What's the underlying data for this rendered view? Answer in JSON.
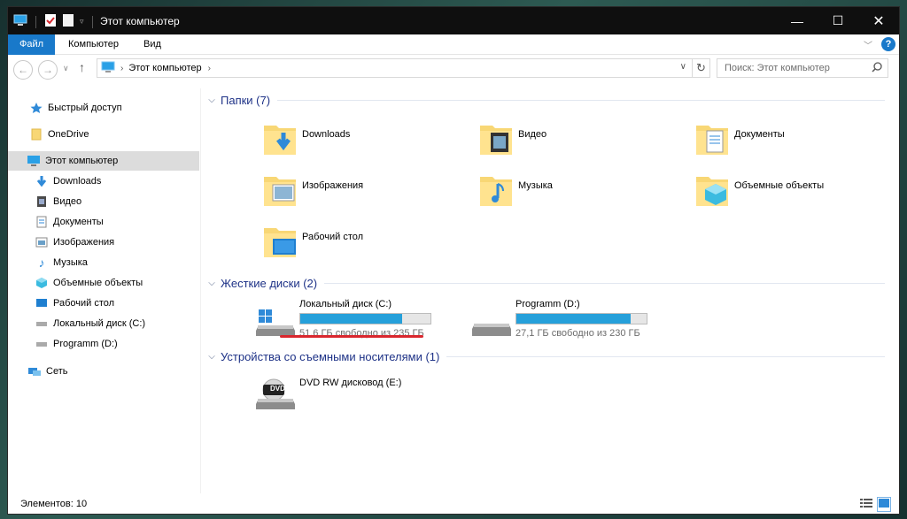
{
  "window": {
    "title": "Этот компьютер"
  },
  "ribbon": {
    "tabs": [
      "Файл",
      "Компьютер",
      "Вид"
    ]
  },
  "address": {
    "path": "Этот компьютер",
    "search_placeholder": "Поиск: Этот компьютер"
  },
  "sidebar": {
    "items": [
      {
        "label": "Быстрый доступ",
        "icon": "star-icon"
      },
      {
        "label": "OneDrive",
        "icon": "onedrive-icon"
      },
      {
        "label": "Этот компьютер",
        "icon": "computer-icon"
      },
      {
        "label": "Downloads",
        "icon": "download-icon"
      },
      {
        "label": "Видео",
        "icon": "video-icon"
      },
      {
        "label": "Документы",
        "icon": "document-icon"
      },
      {
        "label": "Изображения",
        "icon": "image-icon"
      },
      {
        "label": "Музыка",
        "icon": "music-icon"
      },
      {
        "label": "Объемные объекты",
        "icon": "cube-icon"
      },
      {
        "label": "Рабочий стол",
        "icon": "desktop-icon"
      },
      {
        "label": "Локальный диск (C:)",
        "icon": "drive-icon"
      },
      {
        "label": "Programm (D:)",
        "icon": "drive-icon"
      },
      {
        "label": "Сеть",
        "icon": "network-icon"
      }
    ]
  },
  "groups": {
    "folders": {
      "title": "Папки (7)"
    },
    "drives": {
      "title": "Жесткие диски (2)"
    },
    "removable": {
      "title": "Устройства со съемными носителями (1)"
    }
  },
  "folders": [
    "Downloads",
    "Видео",
    "Документы",
    "Изображения",
    "Музыка",
    "Объемные объекты",
    "Рабочий стол"
  ],
  "drives": [
    {
      "name": "Локальный диск (C:)",
      "free": "51,6 ГБ свободно из 235 ГБ",
      "used_fraction": 0.78
    },
    {
      "name": "Programm (D:)",
      "free": "27,1 ГБ свободно из 230 ГБ",
      "used_fraction": 0.88
    }
  ],
  "removable": [
    {
      "name": "DVD RW дисковод (E:)",
      "label": "DVD"
    }
  ],
  "status": {
    "items": "Элементов: 10"
  },
  "colors": {
    "accent": "#1979ca",
    "drive_bar": "#26a0da",
    "highlight": "#d9272e",
    "group_header": "#1e3287"
  }
}
